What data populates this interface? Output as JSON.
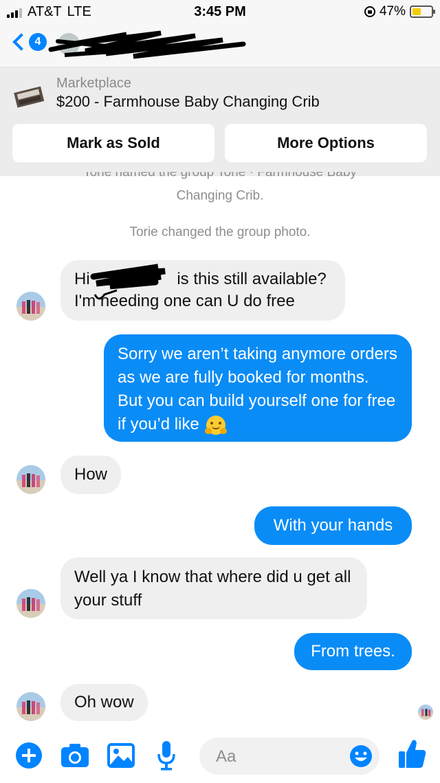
{
  "status_bar": {
    "carrier": "AT&T",
    "network": "LTE",
    "time": "3:45 PM",
    "battery": "47%",
    "battery_level": 0.47
  },
  "nav": {
    "back_badge": "4"
  },
  "marketplace": {
    "label": "Marketplace",
    "listing": "$200 - Farmhouse Baby Changing Crib",
    "mark_sold": "Mark as Sold",
    "more_options": "More Options"
  },
  "system_messages": {
    "renamed": "Torie named the group Torie · Farmhouse Baby",
    "renamed_cont": "Changing Crib.",
    "photo_changed": "Torie changed the group photo."
  },
  "messages": [
    {
      "from": "them",
      "line1_start": "Hi",
      "line1_end": " is this still available?",
      "line2_start": "I'm",
      "line2_end": " needing one can U do free"
    },
    {
      "from": "me",
      "text": "Sorry we aren’t taking anymore orders as we are fully booked for months. But you can build yourself one for free if you’d like"
    },
    {
      "from": "them",
      "text": "How"
    },
    {
      "from": "me",
      "text": "With your hands"
    },
    {
      "from": "them",
      "text": "Well ya I know that where did u get all your stuff"
    },
    {
      "from": "me",
      "text": "From trees."
    },
    {
      "from": "them",
      "text": "Oh wow"
    }
  ],
  "composer": {
    "placeholder": "Aa",
    "icons": [
      "plus-icon",
      "camera-icon",
      "photo-icon",
      "microphone-icon",
      "emoji-icon",
      "thumbs-up-icon"
    ]
  },
  "colors": {
    "accent": "#0084ff",
    "outgoing_bubble": "#0a8cf6",
    "incoming_bubble": "#efefef",
    "battery_fill": "#f5cc00"
  }
}
